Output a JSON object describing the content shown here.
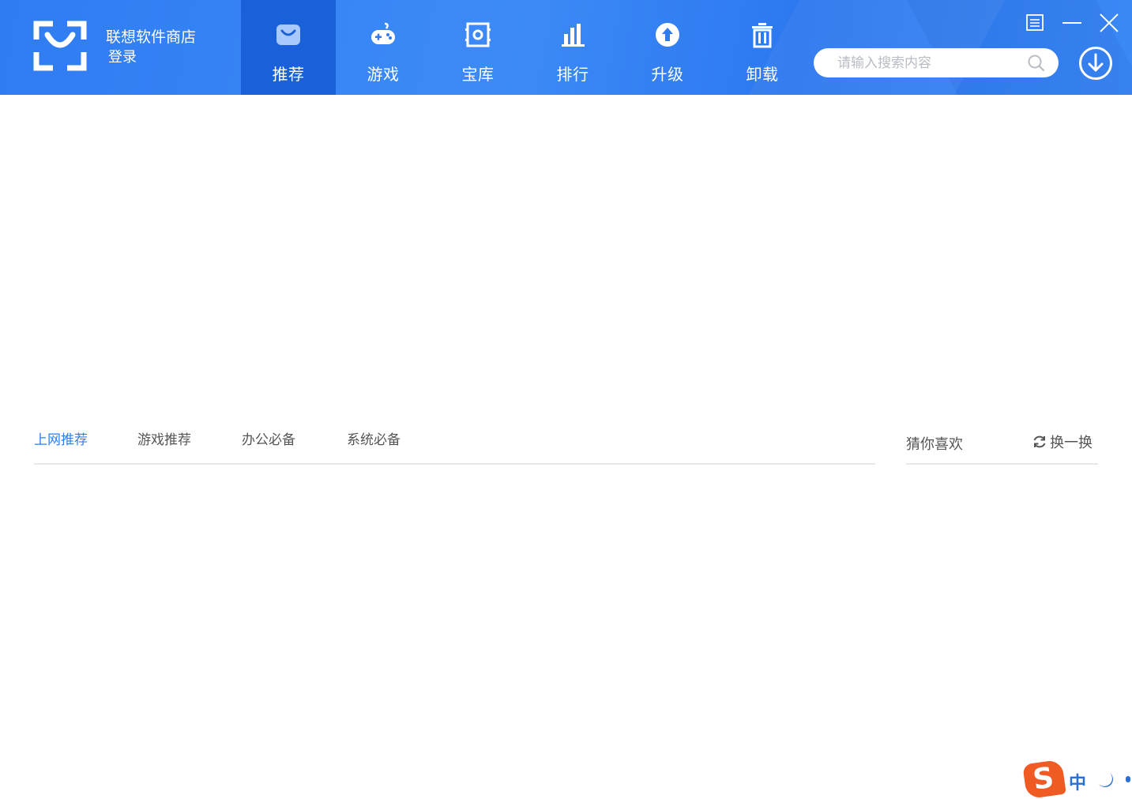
{
  "app": {
    "brand_title": "联想软件商店",
    "login_label": "登录"
  },
  "nav": {
    "items": [
      {
        "label": "推荐",
        "icon": "bag-icon",
        "active": true
      },
      {
        "label": "游戏",
        "icon": "gamepad-icon",
        "active": false
      },
      {
        "label": "宝库",
        "icon": "safe-icon",
        "active": false
      },
      {
        "label": "排行",
        "icon": "bar-chart-icon",
        "active": false
      },
      {
        "label": "升级",
        "icon": "upgrade-arrow-icon",
        "active": false
      },
      {
        "label": "卸载",
        "icon": "trash-icon",
        "active": false
      }
    ]
  },
  "search": {
    "placeholder": "请输入搜索内容",
    "value": ""
  },
  "content": {
    "tabs": [
      {
        "label": "上网推荐",
        "active": true
      },
      {
        "label": "游戏推荐",
        "active": false
      },
      {
        "label": "办公必备",
        "active": false
      },
      {
        "label": "系统必备",
        "active": false
      }
    ],
    "guess": {
      "title": "猜你喜欢",
      "refresh_label": "换一换"
    }
  },
  "ime": {
    "logo_letter": "S",
    "mode_label": "中"
  },
  "colors": {
    "header_blue": "#2f7cf2",
    "active_tab_bg": "#1a60d8",
    "accent": "#2a7ff3",
    "ime_orange": "#f05a23"
  }
}
